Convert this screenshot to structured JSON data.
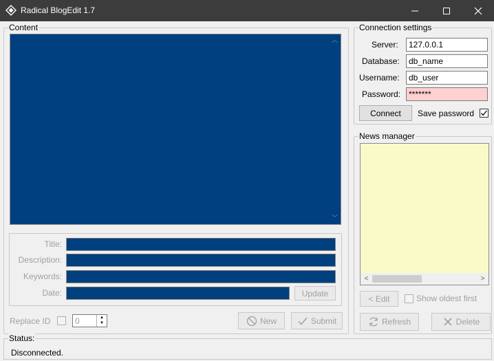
{
  "window": {
    "title": "Radical BlogEdit 1.7",
    "app_icon": "diamond-app-icon",
    "controls": [
      "minimize-icon",
      "maximize-icon",
      "close-icon"
    ]
  },
  "content": {
    "legend": "Content",
    "body_text": ""
  },
  "meta": {
    "title_label": "Title:",
    "title_value": "",
    "description_label": "Description:",
    "description_value": "",
    "keywords_label": "Keywords:",
    "keywords_value": "",
    "date_label": "Date:",
    "date_value": "",
    "update_label": "Update"
  },
  "bottom_bar": {
    "replace_id_label": "Replace ID",
    "replace_id_checked": false,
    "replace_id_value": "0",
    "new_label": "New",
    "submit_label": "Submit"
  },
  "connection": {
    "legend": "Connection settings",
    "server_label": "Server:",
    "server_value": "127.0.0.1",
    "database_label": "Database:",
    "database_value": "db_name",
    "username_label": "Username:",
    "username_value": "db_user",
    "password_label": "Password:",
    "password_value": "*******",
    "connect_label": "Connect",
    "save_password_label": "Save password",
    "save_password_checked": true
  },
  "news": {
    "legend": "News manager",
    "items": [],
    "edit_label": "< Edit",
    "show_oldest_label": "Show oldest first",
    "show_oldest_checked": false,
    "refresh_label": "Refresh",
    "delete_label": "Delete"
  },
  "status": {
    "legend": "Status:",
    "text": "Disconnected."
  },
  "colors": {
    "titlebar": "#3c3c3c",
    "editor_background": "#00407f",
    "news_list_background": "#fafac8",
    "password_background": "#ffd0d0",
    "window_background": "#f0f0f0"
  }
}
